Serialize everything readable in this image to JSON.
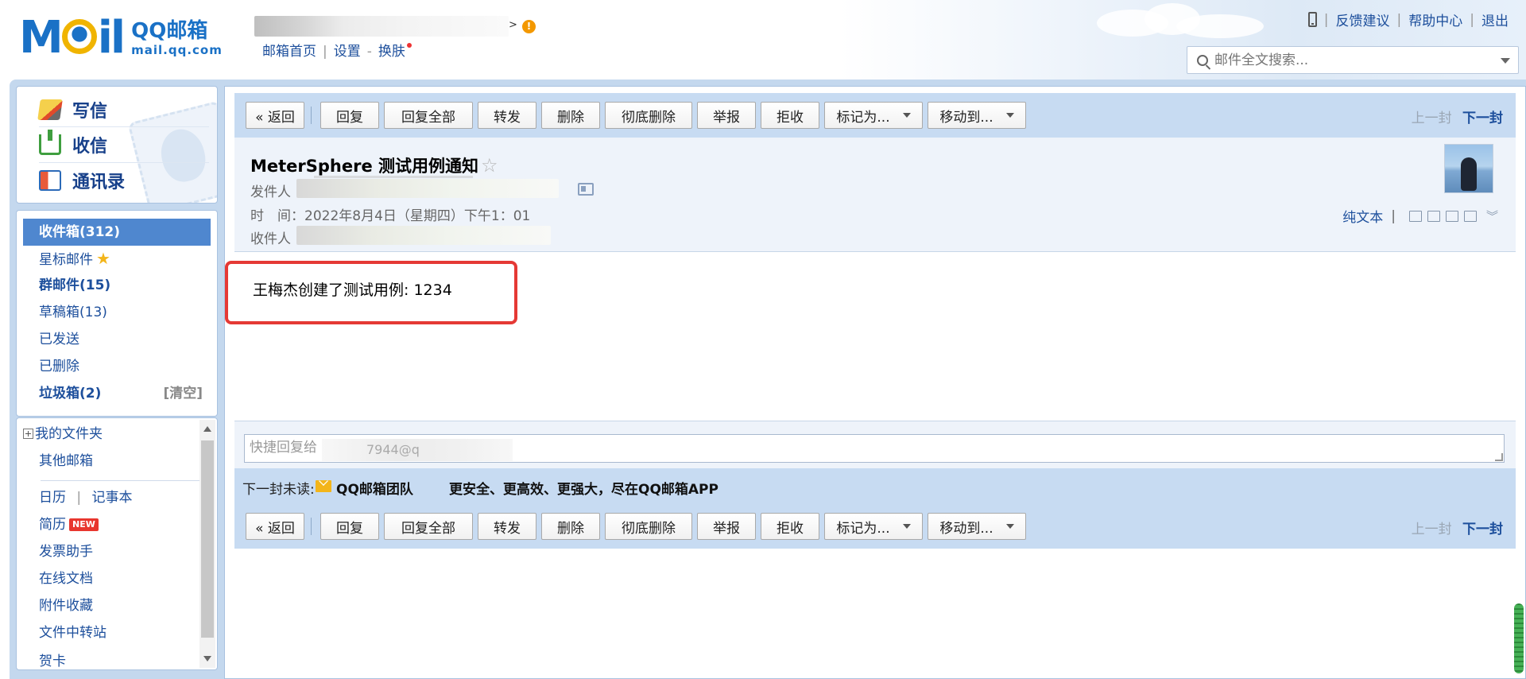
{
  "header": {
    "logo_mail": "Mail",
    "logo_brand": "QQ邮箱",
    "logo_domain": "mail.qq.com",
    "user_arrow": ">",
    "warn_glyph": "!",
    "links": [
      "邮箱首页",
      "设置",
      "换肤"
    ],
    "link_seps": [
      "|",
      "-"
    ],
    "right_links": [
      "反馈建议",
      "帮助中心",
      "退出"
    ],
    "right_sep": "|"
  },
  "search": {
    "placeholder": "邮件全文搜索..."
  },
  "sidebar": {
    "actions": [
      "写信",
      "收信",
      "通讯录"
    ],
    "folders": {
      "inbox": "收件箱(312)",
      "starred": "星标邮件",
      "group": "群邮件(15)",
      "drafts": "草稿箱(13)",
      "sent": "已发送",
      "deleted": "已删除",
      "spam": "垃圾箱(2)",
      "spam_clear": "[清空]"
    },
    "more": {
      "my_folders": "我的文件夹",
      "other_mailbox": "其他邮箱",
      "calendar": "日历",
      "notebook": "记事本",
      "cal_sep": "|",
      "resume": "简历",
      "new_badge": "NEW",
      "invoice": "发票助手",
      "docs": "在线文档",
      "attachments": "附件收藏",
      "transfer": "文件中转站",
      "cut_item": "贺卡"
    }
  },
  "toolbar": {
    "buttons": [
      "« 返回",
      "回复",
      "回复全部",
      "转发",
      "删除",
      "彻底删除",
      "举报",
      "拒收",
      "标记为...",
      "移动到..."
    ],
    "prev": "上一封",
    "next": "下一封"
  },
  "mail": {
    "subject": "MeterSphere 测试用例通知",
    "star": "☆",
    "from_label": "发件人",
    "time_label": "时　间：",
    "time_value": "2022年8月4日（星期四）下午1：01",
    "to_label": "收件人",
    "plain_text": "纯文本",
    "view_sep": "|",
    "body": "王梅杰创建了测试用例: 1234"
  },
  "quick_reply": {
    "placeholder": "快捷回复给",
    "visible_addr": "7944@q"
  },
  "next_unread": {
    "label": "下一封未读:",
    "sender": "QQ邮箱团队",
    "subject": "更安全、更高效、更强大，尽在QQ邮箱APP"
  },
  "colors": {
    "accent": "#1d4f9c",
    "toolbar_bg": "#c7dbf2",
    "frame_bg": "#c4d8ee",
    "selected_folder": "#4f87cf",
    "highlight_box": "#e53935"
  }
}
